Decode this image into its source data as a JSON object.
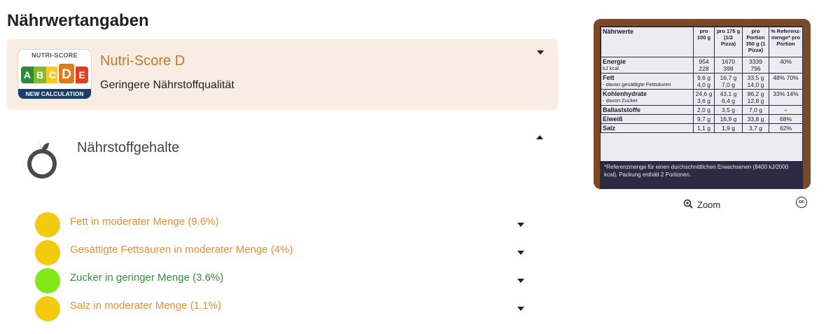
{
  "page": {
    "title": "Nährwertangaben"
  },
  "nutriscore": {
    "badge_title": "NUTRI-SCORE",
    "badge_footer": "NEW CALCULATION",
    "letters": [
      {
        "letter": "A",
        "color": "#2e8a3b"
      },
      {
        "letter": "B",
        "color": "#85bb2f"
      },
      {
        "letter": "C",
        "color": "#f6c927"
      },
      {
        "letter": "D",
        "color": "#e07a1b"
      },
      {
        "letter": "E",
        "color": "#e63c1f"
      }
    ],
    "active_letter": "D",
    "title": "Nutri-Score D",
    "subtitle": "Geringere Nährstoffqualität",
    "title_color": "#c8772a"
  },
  "nutrient_levels": {
    "section_title": "Nährstoffgehalte",
    "items": [
      {
        "label": "Fett in moderater Menge (9.6%)",
        "level": "moderate",
        "dot_color": "#f2cb0e",
        "text_color": "#e08f3a"
      },
      {
        "label": "Gesättigte Fettsäuren in moderater Menge (4%)",
        "level": "moderate",
        "dot_color": "#f2cb0e",
        "text_color": "#e08f3a"
      },
      {
        "label": "Zucker in geringer Menge (3.6%)",
        "level": "low",
        "dot_color": "#80e815",
        "text_color": "#3a8a3a"
      },
      {
        "label": "Salz in moderater Menge (1.1%)",
        "level": "moderate",
        "dot_color": "#f2cb0e",
        "text_color": "#e08f3a"
      }
    ]
  },
  "nutrition_photo": {
    "headers": [
      "Nährwerte",
      "pro 100 g",
      "pro 175 g (1/2 Pizza)",
      "pro Portion 350 g (1 Pizza)",
      "% Referenz-menge* pro Portion"
    ],
    "rows": [
      {
        "name": "Energie",
        "sub": "kJ kcal",
        "v100": "954 228",
        "vhalf": "1670 398",
        "vportion": "3339 796",
        "ref": "40%"
      },
      {
        "name": "Fett",
        "sub": "- davon gesättigte Fettsäuren",
        "v100": "9,6 g 4,0 g",
        "vhalf": "16,7 g 7,0 g",
        "vportion": "33,5 g 14,0 g",
        "ref": "48% 70%"
      },
      {
        "name": "Kohlenhydrate",
        "sub": "- davon Zucker",
        "v100": "24,6 g 3,6 g",
        "vhalf": "43,1 g 6,4 g",
        "vportion": "86,2 g 12,8 g",
        "ref": "33% 14%"
      },
      {
        "name": "Ballaststoffe",
        "sub": "",
        "v100": "2,0 g",
        "vhalf": "3,5 g",
        "vportion": "7,0 g",
        "ref": "–"
      },
      {
        "name": "Eiweiß",
        "sub": "",
        "v100": "9,7 g",
        "vhalf": "16,9 g",
        "vportion": "33,8 g",
        "ref": "68%"
      },
      {
        "name": "Salz",
        "sub": "",
        "v100": "1,1 g",
        "vhalf": "1,9 g",
        "vportion": "3,7 g",
        "ref": "62%"
      }
    ],
    "footnote": "*Referenzmenge für einen durchschnittlichen Erwachsenen (8400 kJ/2000 kcal). Packung enthält 2 Portionen.",
    "zoom_label": "Zoom",
    "license_label": "cc"
  }
}
